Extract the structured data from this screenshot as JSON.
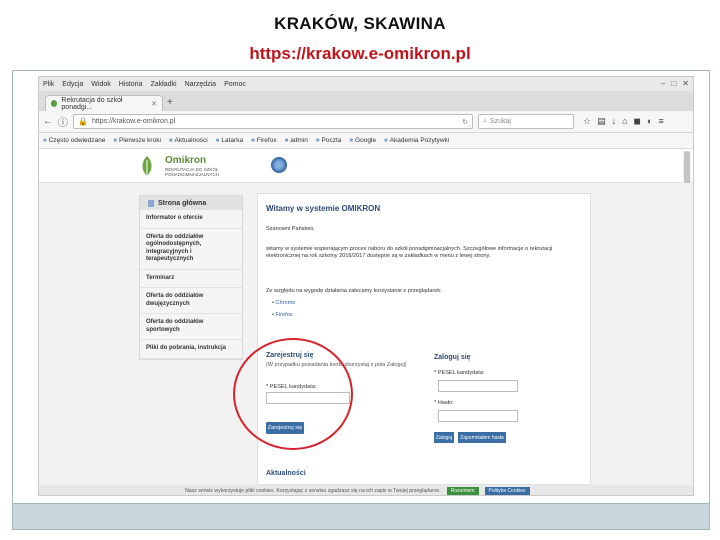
{
  "slide": {
    "title": "KRAKÓW, SKAWINA",
    "url": "https://krakow.e-omikron.pl"
  },
  "browser": {
    "menu": [
      "Plik",
      "Edycja",
      "Widok",
      "Historia",
      "Zakładki",
      "Narzędzia",
      "Pomoc"
    ],
    "tab_title": "Rekrutacja do szkół ponadgi...",
    "address": "https://krakow.e-omikron.pl",
    "search_placeholder": "Szukaj",
    "bookmarks": [
      "Często odwiedzane",
      "Pierwsze kroki",
      "Aktualności",
      "Latarka",
      "Firefox",
      "admin",
      "Poczta",
      "Google",
      "Akademia Pozytywki"
    ]
  },
  "site": {
    "logo_name": "Omikron",
    "logo_sub": "REKRUTACJA DO SZKÓŁ PONADGIMNAZJALNYCH",
    "sidebar_header": "Strona główna",
    "sidebar_items": [
      "Informator o ofercie",
      "Oferta do oddziałów ogólnodostępnych, integracyjnych i terapeutycznych",
      "Terminarz",
      "Oferta do oddziałów dwujęzycznych",
      "Oferta do oddziałów sportowych",
      "Pliki do pobrania, instrukcja"
    ],
    "content_title": "Witamy w systemie OMIKRON",
    "greeting": "Szanowni Państwo,",
    "paragraph": "witamy w systemie wspierającym proces naboru do szkół ponadgimnazjalnych. Szczegółowe informacje o rekrutacji elektronicznej na rok szkolny 2016/2017 dostępne są w zakładkach w menu z lewej strony.",
    "browsers_note": "Ze względu na wygodę działania zalecamy korzystanie z przeglądarek:",
    "browsers": [
      "Chrome",
      "Firefox"
    ],
    "register_title": "Zarejestruj się",
    "register_note": "(W przypadku posiadania konta skorzystaj z pola Zaloguj)",
    "pesel_label_register": "* PESEL kandydata:",
    "register_button": "Zarejestruj się",
    "login_title": "Zaloguj się",
    "pesel_label_login": "* PESEL kandydata:",
    "password_label": "* Hasło:",
    "login_button": "Zaloguj",
    "forgot_button": "Zapomniałem hasła",
    "news_title": "Aktualności",
    "cookie_text": "Nasz serwis wykorzystuje pliki cookies. Korzystając z serwisu zgadzasz się na ich zapis w Twojej przeglądarce.",
    "cookie_ok": "Rozumiem",
    "cookie_policy": "Polityka Cookies"
  },
  "colors": {
    "accent_title": "#c0141c",
    "highlight_ring": "#d6232b",
    "button_blue": "#3a6ea5",
    "brand_green": "#5d8d3a"
  }
}
